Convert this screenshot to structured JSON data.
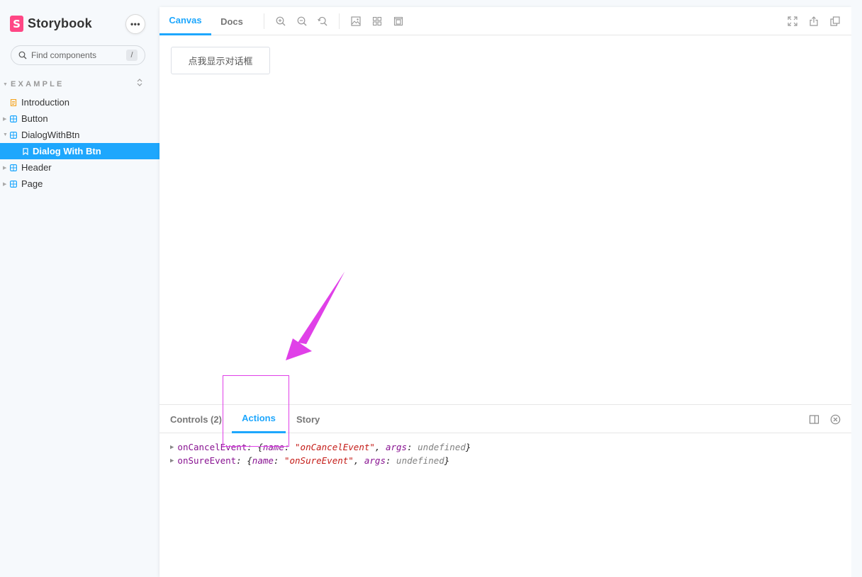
{
  "sidebar": {
    "brand": "Storybook",
    "brand_logo_letter": "S",
    "menu_label": "•••",
    "search": {
      "placeholder": "Find components",
      "shortcut": "/"
    },
    "group": "EXAMPLE",
    "items": [
      {
        "label": "Introduction",
        "icon": "document-icon"
      },
      {
        "label": "Button",
        "icon": "component-icon"
      },
      {
        "label": "DialogWithBtn",
        "icon": "component-icon"
      },
      {
        "label": "Dialog With Btn",
        "icon": "bookmark-icon",
        "selected": true
      },
      {
        "label": "Header",
        "icon": "component-icon"
      },
      {
        "label": "Page",
        "icon": "component-icon"
      }
    ]
  },
  "toolbar": {
    "tabs": [
      {
        "label": "Canvas",
        "active": true
      },
      {
        "label": "Docs",
        "active": false
      }
    ],
    "icons": [
      "zoom-in-icon",
      "zoom-out-icon",
      "zoom-reset-icon",
      "background-icon",
      "grid-icon",
      "measure-icon",
      "fullscreen-icon",
      "share-icon",
      "copy-link-icon"
    ]
  },
  "canvas": {
    "button_label": "点我显示对话框"
  },
  "addons": {
    "tabs": [
      {
        "label": "Controls (2)",
        "active": false
      },
      {
        "label": "Actions",
        "active": true
      },
      {
        "label": "Story",
        "active": false
      }
    ],
    "icons": [
      "panel-orientation-icon",
      "close-circle-icon"
    ],
    "log": [
      {
        "event": "onCancelEvent",
        "name_value": "\"onCancelEvent\"",
        "args_value": "undefined"
      },
      {
        "event": "onSureEvent",
        "name_value": "\"onSureEvent\"",
        "args_value": "undefined"
      }
    ],
    "log_keys": {
      "name": "name",
      "args": "args"
    }
  },
  "colors": {
    "accent": "#1ea7fd",
    "brand": "#ff4785",
    "annotation": "#e040e8"
  }
}
